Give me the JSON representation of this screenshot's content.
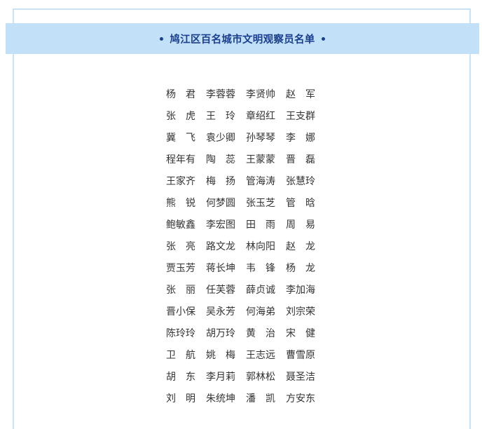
{
  "header": {
    "title": "鸠江区百名城市文明观察员名单"
  },
  "names": [
    [
      "杨　君",
      "李蓉蓉",
      "李贤帅",
      "赵　军"
    ],
    [
      "张　虎",
      "王　玲",
      "章绍红",
      "王支群"
    ],
    [
      "冀　飞",
      "袁少卿",
      "孙琴琴",
      "李　娜"
    ],
    [
      "程年有",
      "陶　蕊",
      "王蒙蒙",
      "晋　磊"
    ],
    [
      "王家齐",
      "梅　扬",
      "管海涛",
      "张慧玲"
    ],
    [
      "熊　锐",
      "何梦圆",
      "张玉芝",
      "管　晗"
    ],
    [
      "鲍敏鑫",
      "李宏图",
      "田　雨",
      "周　易"
    ],
    [
      "张　亮",
      "路文龙",
      "林向阳",
      "赵　龙"
    ],
    [
      "贾玉芳",
      "蒋长坤",
      "韦　锋",
      "杨　龙"
    ],
    [
      "张　丽",
      "任芙蓉",
      "薛贞诚",
      "李加海"
    ],
    [
      "晋小保",
      "吴永芳",
      "何海弟",
      "刘宗荣"
    ],
    [
      "陈玲玲",
      "胡万玲",
      "黄　治",
      "宋　健"
    ],
    [
      "卫　航",
      "姚　梅",
      "王志远",
      "曹雪原"
    ],
    [
      "胡　东",
      "李月莉",
      "郭林松",
      "聂圣洁"
    ],
    [
      "刘　明",
      "朱统坤",
      "潘　凯",
      "方安东"
    ]
  ]
}
